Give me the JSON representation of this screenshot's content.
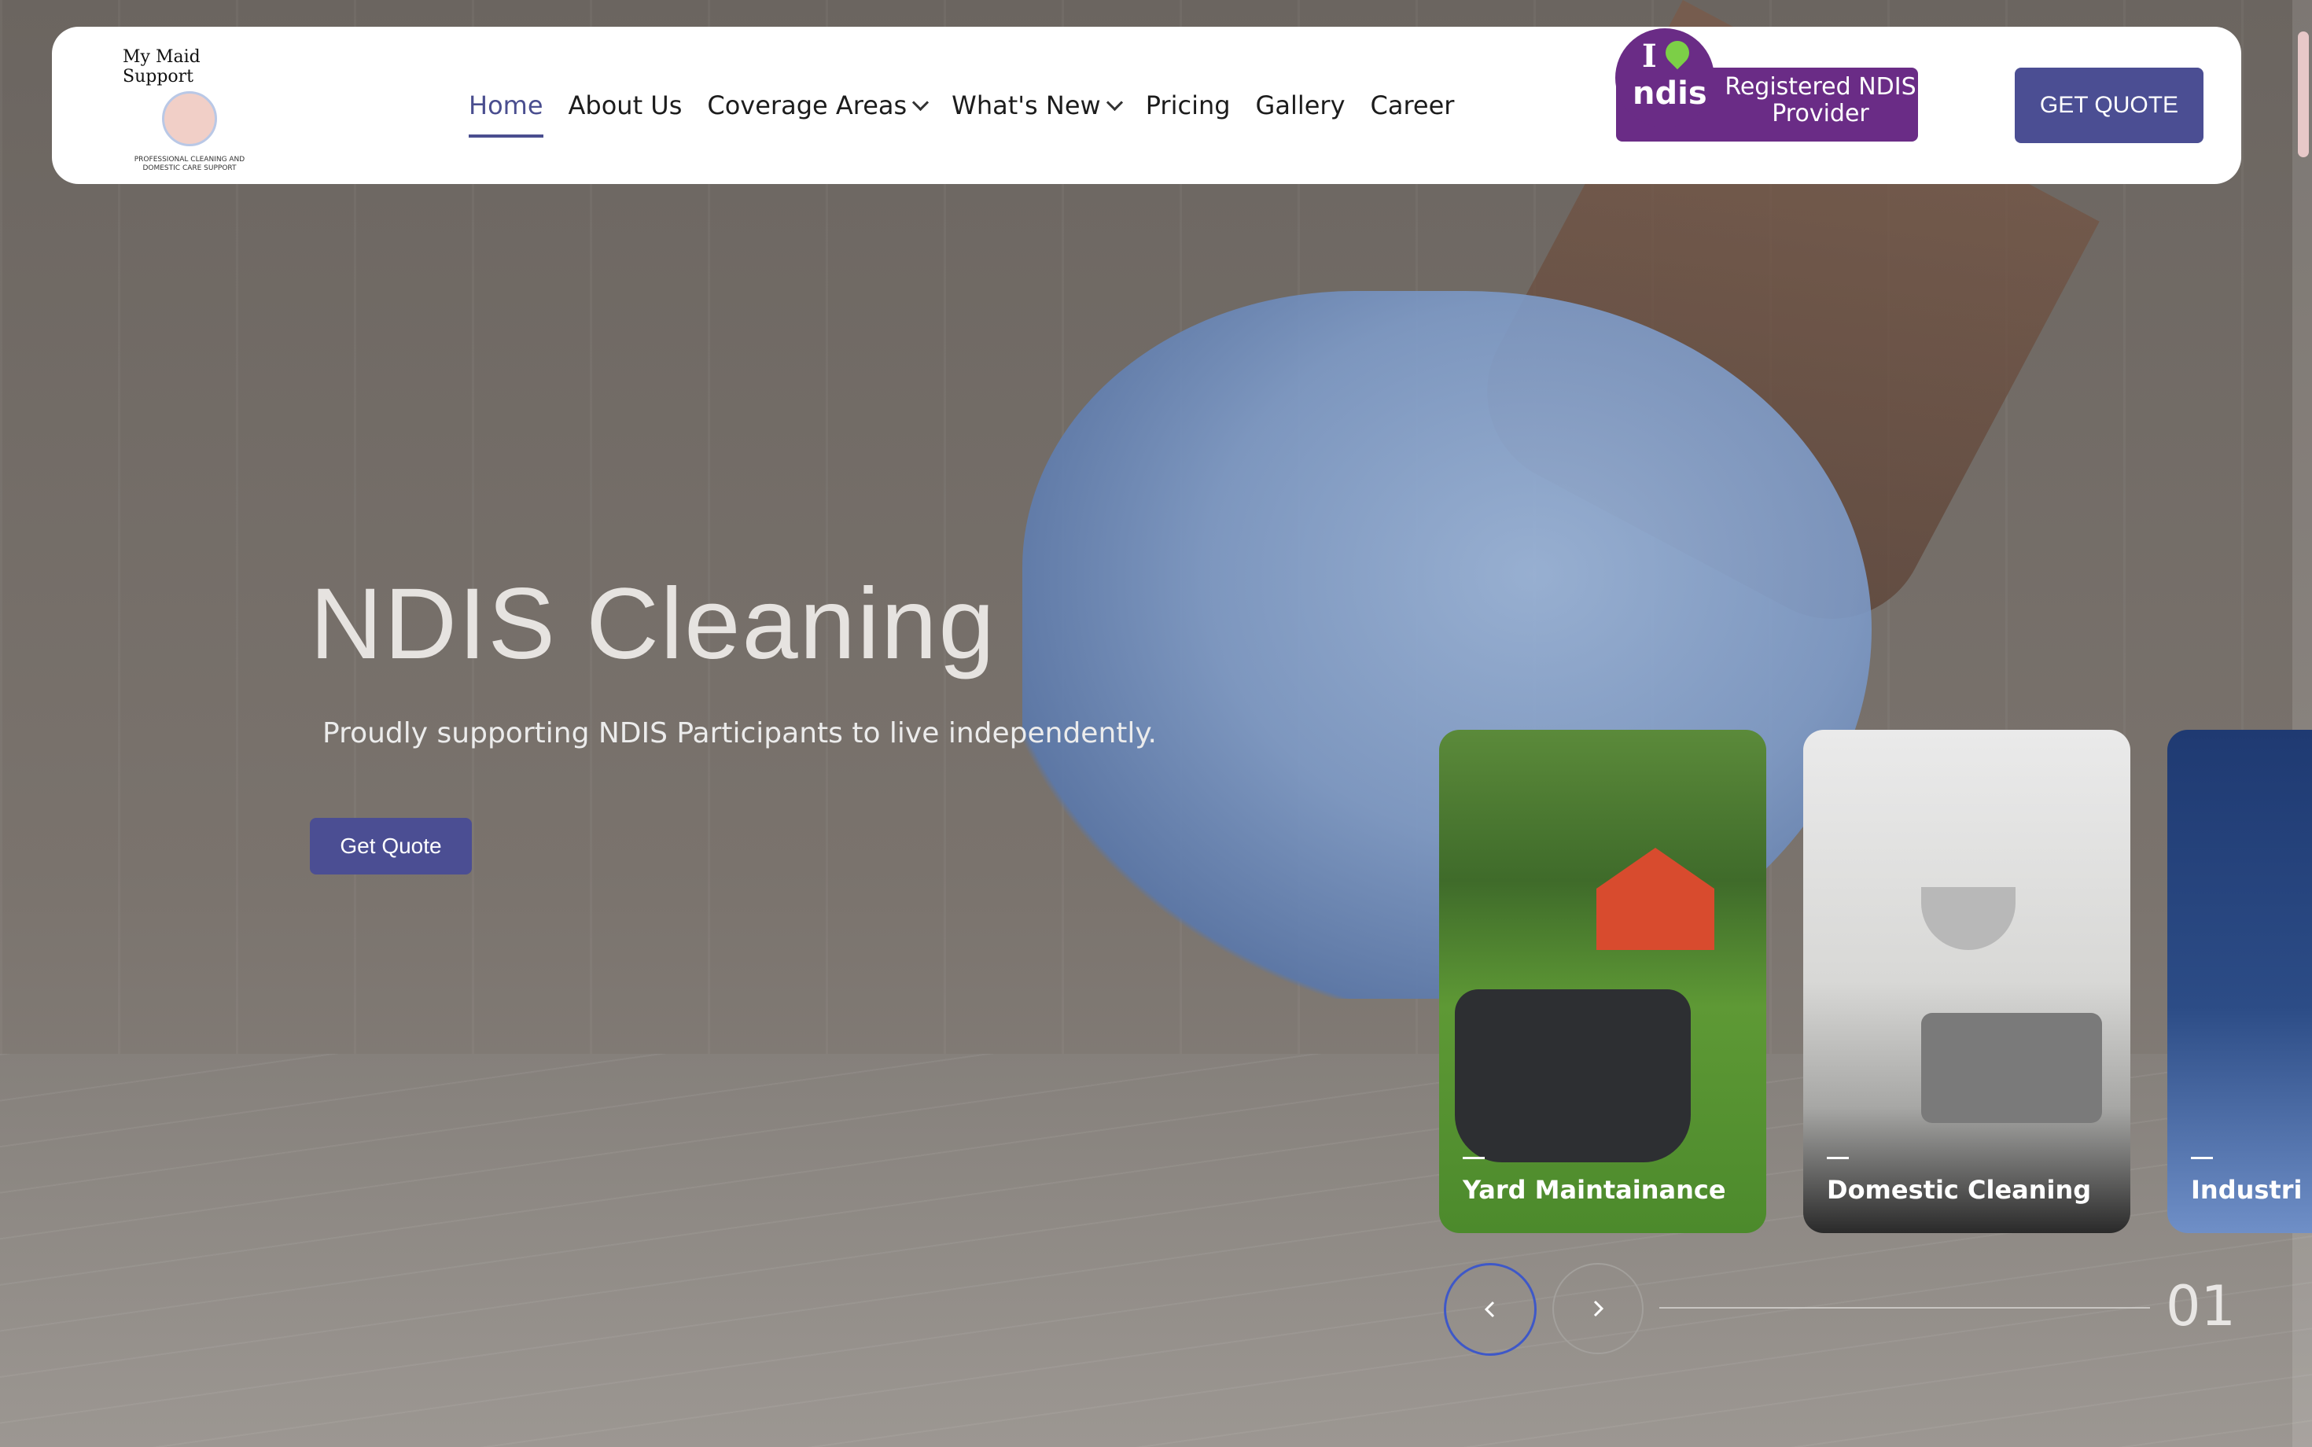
{
  "header": {
    "logo": {
      "arc_text": "My Maid Support",
      "subtitle": "PROFESSIONAL CLEANING AND DOMESTIC CARE SUPPORT"
    },
    "nav": [
      {
        "label": "Home",
        "active": true
      },
      {
        "label": "About Us"
      },
      {
        "label": "Coverage Areas",
        "dropdown": true
      },
      {
        "label": "What's New",
        "dropdown": true
      },
      {
        "label": "Pricing"
      },
      {
        "label": "Gallery"
      },
      {
        "label": "Career"
      }
    ],
    "ndis": {
      "logo_i": "I",
      "logo_word": "ndis",
      "text_line1": "Registered NDIS",
      "text_line2": "Provider"
    },
    "cta_label": "GET QUOTE"
  },
  "hero": {
    "title": "NDIS Cleaning",
    "subtitle": "Proudly supporting NDIS Participants to live independently.",
    "button_label": "Get Quote"
  },
  "slider": {
    "cards": [
      {
        "label": "Yard Maintainance"
      },
      {
        "label": "Domestic Cleaning"
      },
      {
        "label": "Industri"
      }
    ],
    "prev_icon": "chevron-left-icon",
    "next_icon": "chevron-right-icon",
    "counter": "01"
  },
  "colors": {
    "accent": "#4b4e93",
    "ndis_purple": "#6a2c86",
    "ndis_green": "#7ccf47"
  }
}
